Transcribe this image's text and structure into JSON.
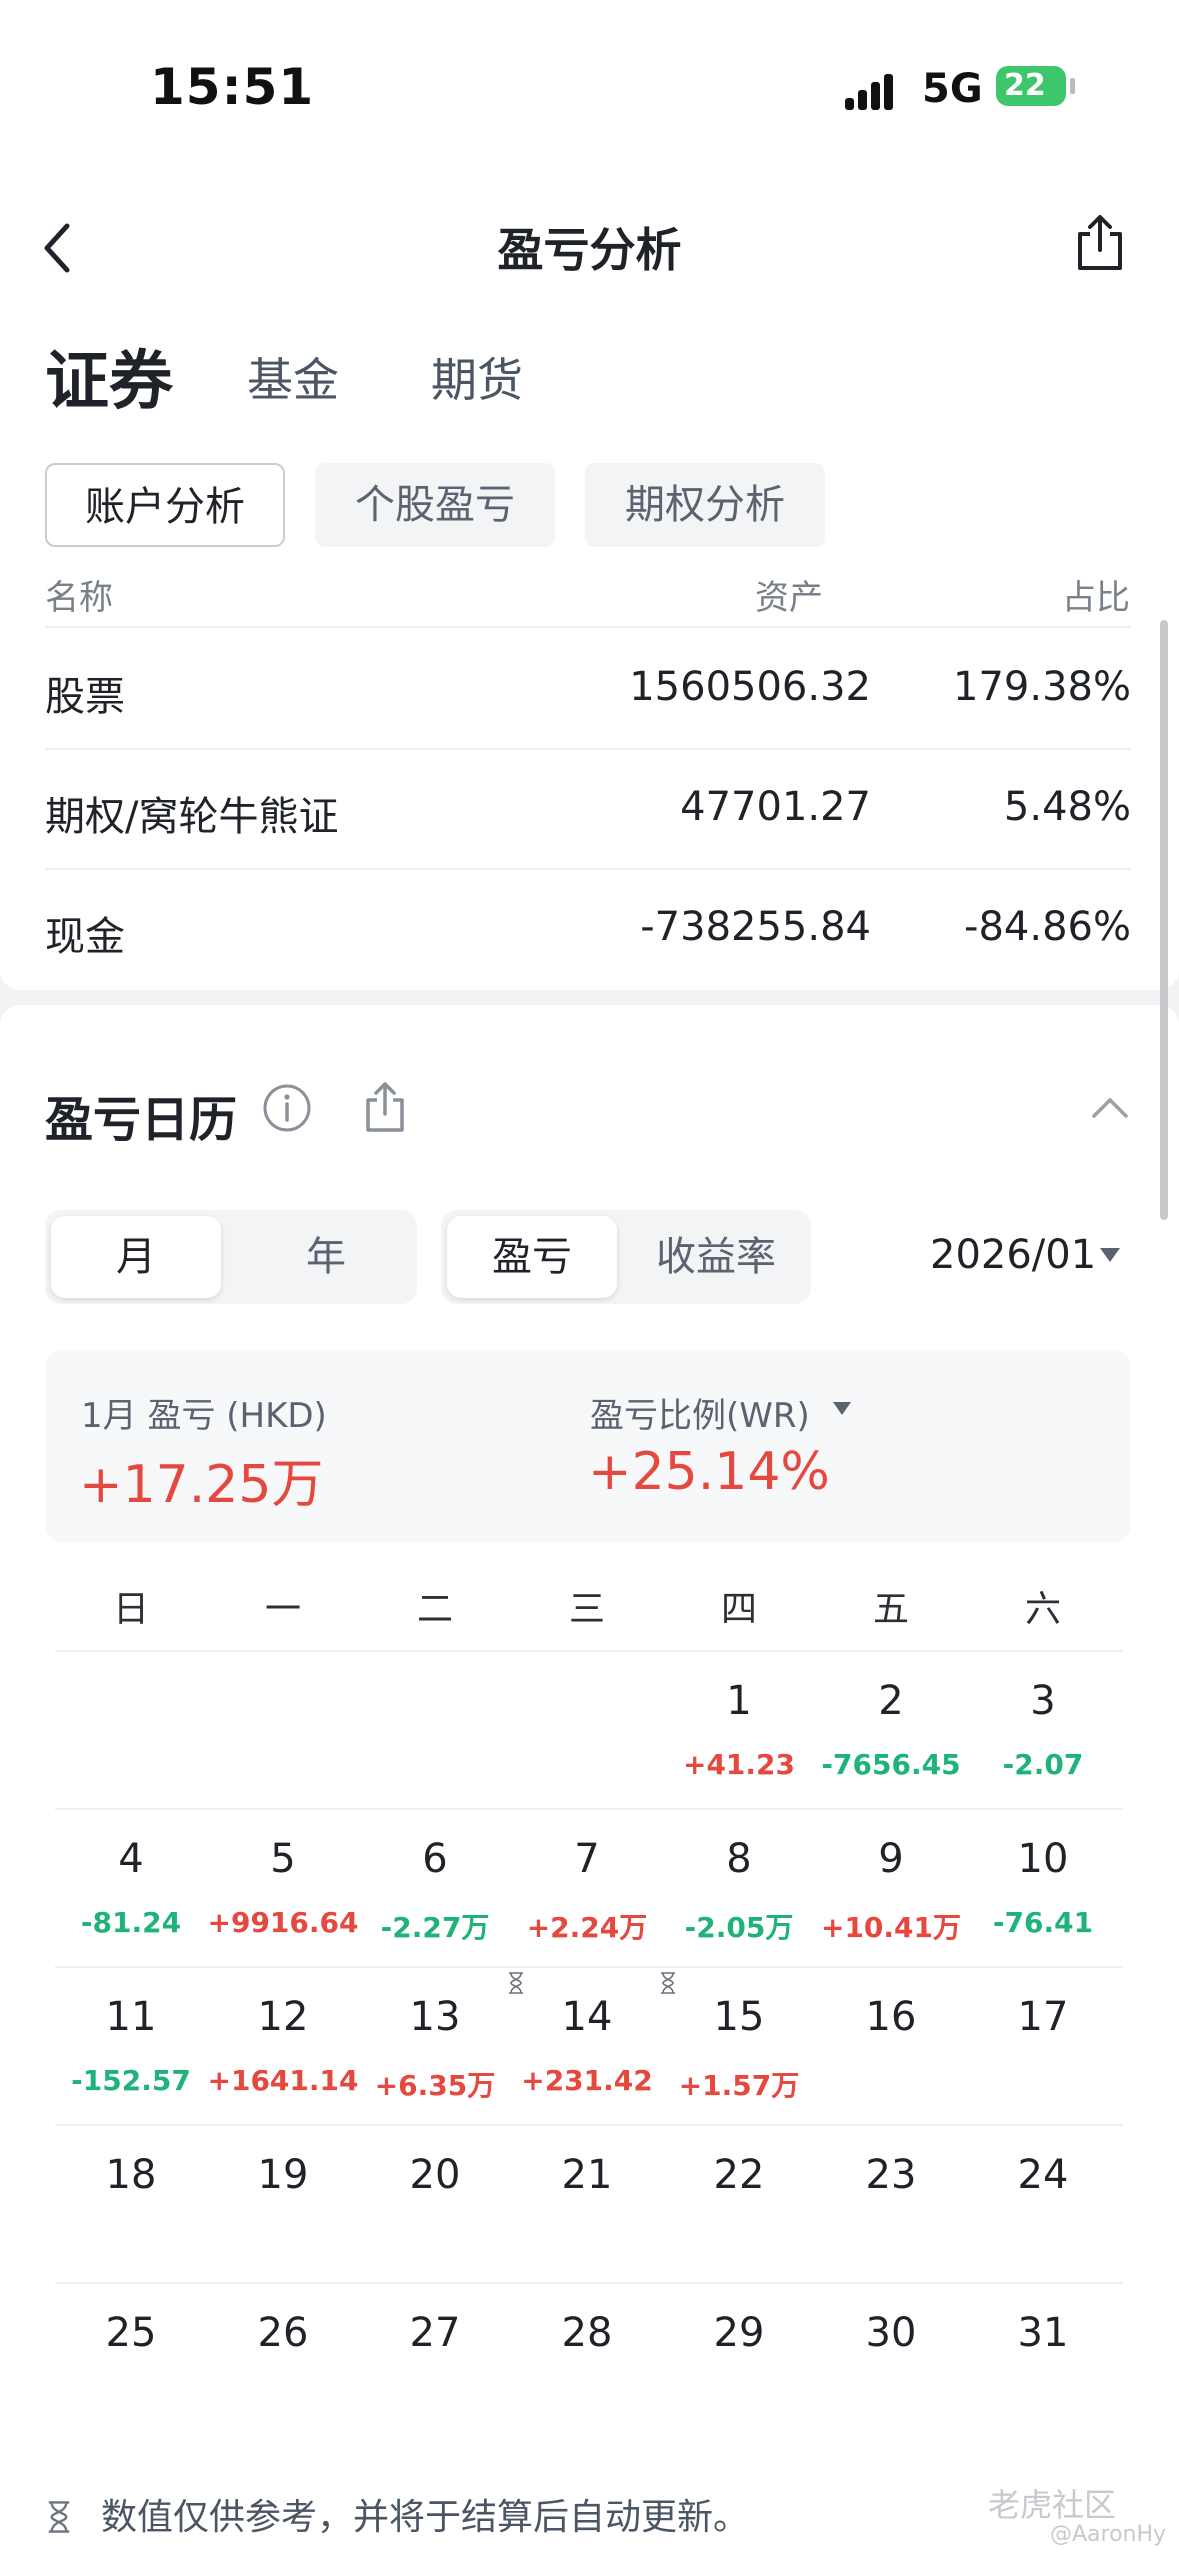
{
  "status_bar": {
    "time": "15:51",
    "network": "5G",
    "battery": "22"
  },
  "header": {
    "title": "盈亏分析"
  },
  "asset_tabs": [
    "证券",
    "基金",
    "期货"
  ],
  "analysis_tabs": [
    "账户分析",
    "个股盈亏",
    "期权分析"
  ],
  "table": {
    "headers": {
      "name": "名称",
      "asset": "资产",
      "ratio": "占比"
    },
    "rows": [
      {
        "name": "股票",
        "asset": "1560506.32",
        "ratio": "179.38%"
      },
      {
        "name": "期权/窝轮牛熊证",
        "asset": "47701.27",
        "ratio": "5.48%"
      },
      {
        "name": "现金",
        "asset": "-738255.84",
        "ratio": "-84.86%"
      }
    ]
  },
  "calendar": {
    "title": "盈亏日历",
    "period_toggle": [
      "月",
      "年"
    ],
    "metric_toggle": [
      "盈亏",
      "收益率"
    ],
    "month": "2026/01",
    "summary": {
      "pnl_label": "1月 盈亏 (HKD)",
      "pnl_value": "+17.25万",
      "wr_label": "盈亏比例(WR)",
      "wr_value": "+25.14%"
    },
    "weekdays": [
      "日",
      "一",
      "二",
      "三",
      "四",
      "五",
      "六"
    ],
    "weeks": [
      [
        {
          "d": ""
        },
        {
          "d": ""
        },
        {
          "d": ""
        },
        {
          "d": ""
        },
        {
          "d": "1",
          "v": "+41.23",
          "s": "pos"
        },
        {
          "d": "2",
          "v": "-7656.45",
          "s": "neg"
        },
        {
          "d": "3",
          "v": "-2.07",
          "s": "neg"
        }
      ],
      [
        {
          "d": "4",
          "v": "-81.24",
          "s": "neg"
        },
        {
          "d": "5",
          "v": "+9916.64",
          "s": "pos"
        },
        {
          "d": "6",
          "v": "-2.27万",
          "s": "neg"
        },
        {
          "d": "7",
          "v": "+2.24万",
          "s": "pos"
        },
        {
          "d": "8",
          "v": "-2.05万",
          "s": "neg"
        },
        {
          "d": "9",
          "v": "+10.41万",
          "s": "pos"
        },
        {
          "d": "10",
          "v": "-76.41",
          "s": "neg"
        }
      ],
      [
        {
          "d": "11",
          "v": "-152.57",
          "s": "neg"
        },
        {
          "d": "12",
          "v": "+1641.14",
          "s": "pos"
        },
        {
          "d": "13",
          "v": "+6.35万",
          "s": "pos"
        },
        {
          "d": "14",
          "v": "+231.42",
          "s": "pos",
          "pending": true
        },
        {
          "d": "15",
          "v": "+1.57万",
          "s": "pos",
          "pending": true
        },
        {
          "d": "16"
        },
        {
          "d": "17"
        }
      ],
      [
        {
          "d": "18"
        },
        {
          "d": "19"
        },
        {
          "d": "20"
        },
        {
          "d": "21"
        },
        {
          "d": "22"
        },
        {
          "d": "23"
        },
        {
          "d": "24"
        }
      ],
      [
        {
          "d": "25"
        },
        {
          "d": "26"
        },
        {
          "d": "27"
        },
        {
          "d": "28"
        },
        {
          "d": "29"
        },
        {
          "d": "30"
        },
        {
          "d": "31"
        }
      ]
    ],
    "footnote": "数值仅供参考，并将于结算后自动更新。"
  },
  "watermark": {
    "brand": "老虎社区",
    "user": "@AaronHy"
  },
  "colors": {
    "profit": "#e5483f",
    "loss": "#1fb37a"
  }
}
